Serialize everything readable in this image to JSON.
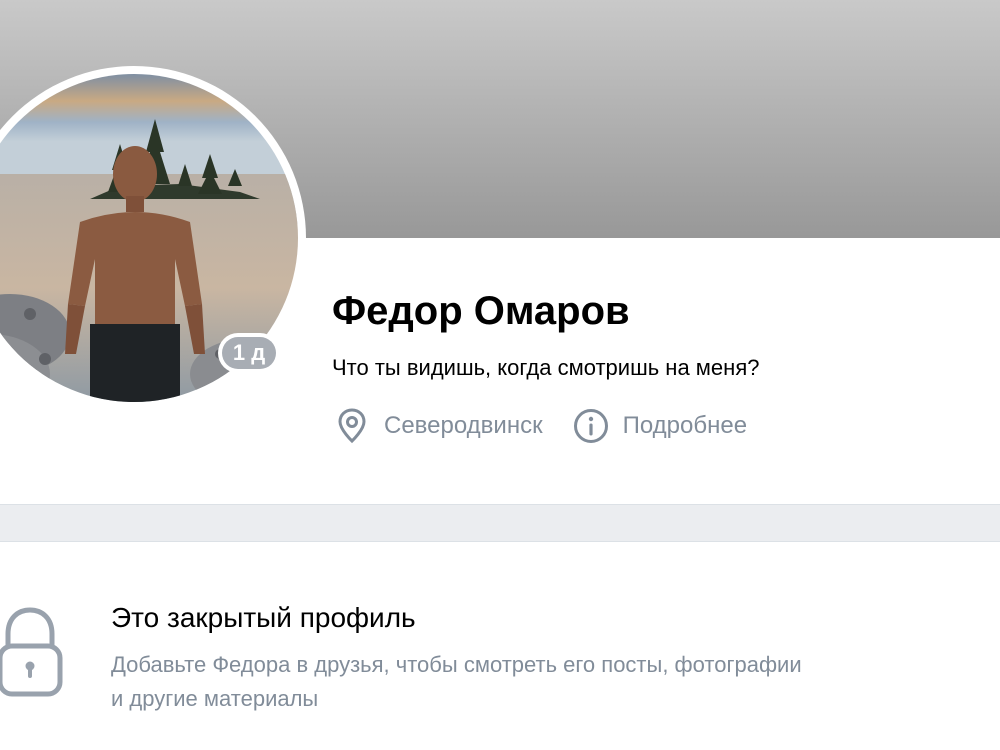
{
  "profile": {
    "name": "Федор Омаров",
    "status": "Что ты видишь, когда смотришь на меня?",
    "last_seen_badge": "1 д",
    "city": "Северодвинск",
    "more_info": "Подробнее"
  },
  "locked": {
    "title": "Это закрытый профиль",
    "description_line1": "Добавьте Федора в друзья, чтобы смотреть его посты, фотографии",
    "description_line2": "и другие материалы"
  },
  "icons": {
    "location": "location-pin-icon",
    "info": "info-circle-icon",
    "lock": "lock-icon"
  },
  "colors": {
    "secondary_text": "#818c99",
    "page_background": "#ebedf0",
    "badge": "#a8adb4"
  }
}
